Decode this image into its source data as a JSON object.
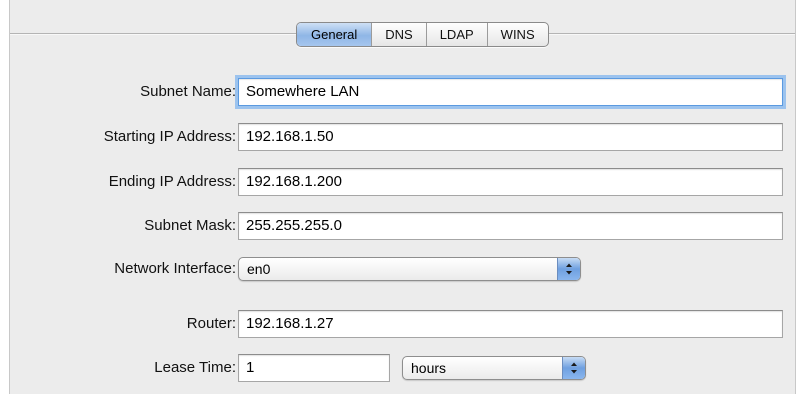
{
  "tabs": [
    {
      "label": "General",
      "selected": true
    },
    {
      "label": "DNS",
      "selected": false
    },
    {
      "label": "LDAP",
      "selected": false
    },
    {
      "label": "WINS",
      "selected": false
    }
  ],
  "form": {
    "subnet_name": {
      "label": "Subnet Name:",
      "value": "Somewhere LAN"
    },
    "starting_ip": {
      "label": "Starting IP Address:",
      "value": "192.168.1.50"
    },
    "ending_ip": {
      "label": "Ending IP Address:",
      "value": "192.168.1.200"
    },
    "subnet_mask": {
      "label": "Subnet Mask:",
      "value": "255.255.255.0"
    },
    "network_interface": {
      "label": "Network Interface:",
      "value": "en0"
    },
    "router": {
      "label": "Router:",
      "value": "192.168.1.27"
    },
    "lease_time": {
      "label": "Lease Time:",
      "value": "1",
      "unit": "hours"
    }
  },
  "colors": {
    "accent": "#6fa0e0",
    "focus_ring": "#9cc3ee",
    "panel_bg": "#ececec"
  }
}
